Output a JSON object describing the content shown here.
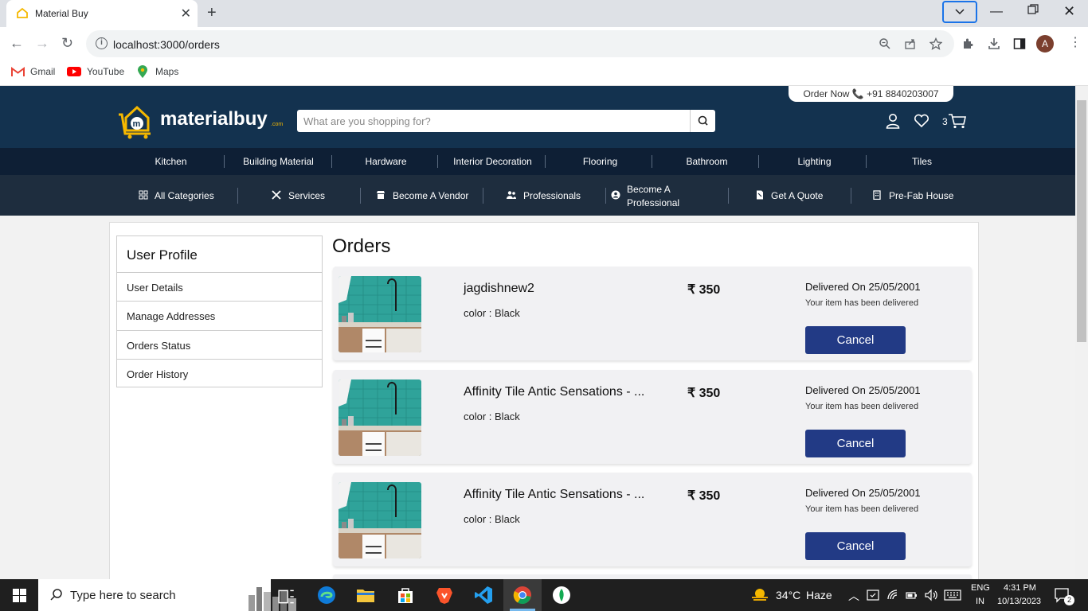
{
  "browser": {
    "tab_title": "Material Buy",
    "url": "localhost:3000/orders",
    "avatar_letter": "A",
    "bookmarks": [
      "Gmail",
      "YouTube",
      "Maps"
    ]
  },
  "header": {
    "order_now": "Order Now",
    "phone": "+91 8840203007",
    "logo_text": "materialbuy",
    "logo_suffix": ".com",
    "search_placeholder": "What are you shopping for?",
    "cart_count": "3"
  },
  "categories": [
    "Kitchen",
    "Building Material",
    "Hardware",
    "Interior Decoration",
    "Flooring",
    "Bathroom",
    "Lighting",
    "Tiles"
  ],
  "subnav": {
    "all_categories": "All Categories",
    "services": "Services",
    "become_vendor": "Become A Vendor",
    "professionals": "Professionals",
    "become_professional_1": "Become A",
    "become_professional_2": "Professional",
    "get_quote": "Get A Quote",
    "prefab": "Pre-Fab House"
  },
  "sidebar": {
    "title": "User Profile",
    "items": [
      "User Details",
      "Manage Addresses",
      "Orders Status",
      "Order History"
    ]
  },
  "orders": {
    "title": "Orders",
    "items": [
      {
        "name": "jagdishnew2",
        "color": "color : Black",
        "price": "₹ 350",
        "status": "Delivered On 25/05/2001",
        "sub_status": "Your item has been delivered",
        "cancel": "Cancel"
      },
      {
        "name": "Affinity Tile Antic Sensations - ...",
        "color": "color : Black",
        "price": "₹ 350",
        "status": "Delivered On 25/05/2001",
        "sub_status": "Your item has been delivered",
        "cancel": "Cancel"
      },
      {
        "name": "Affinity Tile Antic Sensations - ...",
        "color": "color : Black",
        "price": "₹ 350",
        "status": "Delivered On 25/05/2001",
        "sub_status": "Your item has been delivered",
        "cancel": "Cancel"
      }
    ]
  },
  "taskbar": {
    "search_placeholder": "Type here to search",
    "weather_temp": "34°C",
    "weather_desc": "Haze",
    "lang_1": "ENG",
    "lang_2": "IN",
    "time": "4:31 PM",
    "date": "10/13/2023",
    "notifications": "2"
  },
  "colors": {
    "header_bg": "#13324f",
    "category_bg": "#0e1f35",
    "subnav_bg": "#1e2d3e",
    "button_bg": "#223a85",
    "logo_accent": "#f5b800"
  }
}
